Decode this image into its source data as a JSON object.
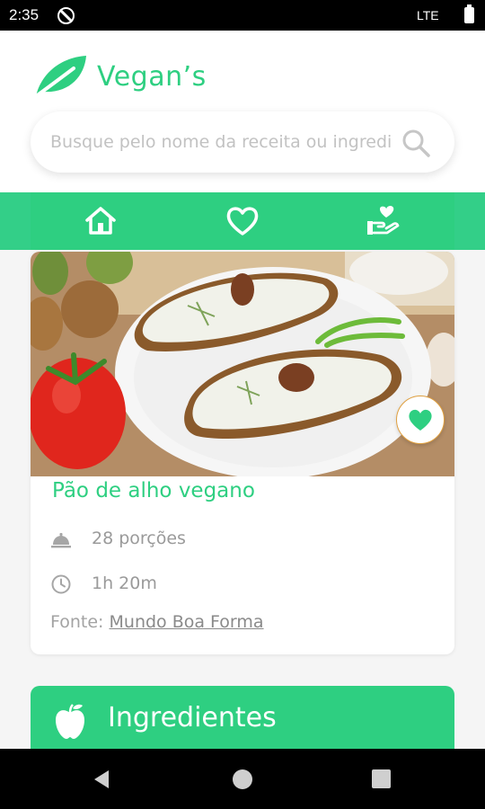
{
  "status_bar": {
    "time": "2:35",
    "network": "LTE"
  },
  "app": {
    "name": "Vegan’s",
    "accent_color": "#2ecf81"
  },
  "search": {
    "placeholder": "Busque pelo nome da receita ou ingrediente",
    "value": ""
  },
  "nav": {
    "items": [
      {
        "icon": "home-icon"
      },
      {
        "icon": "heart-icon"
      },
      {
        "icon": "donation-icon"
      }
    ]
  },
  "recipe": {
    "title": "Pão de alho vegano",
    "portions": "28 porções",
    "time": "1h 20m",
    "source_label": "Fonte:",
    "source_link": "Mundo Boa Forma",
    "image_icon": "garlic-bread-photo"
  },
  "ingredients": {
    "title": "Ingredientes"
  }
}
